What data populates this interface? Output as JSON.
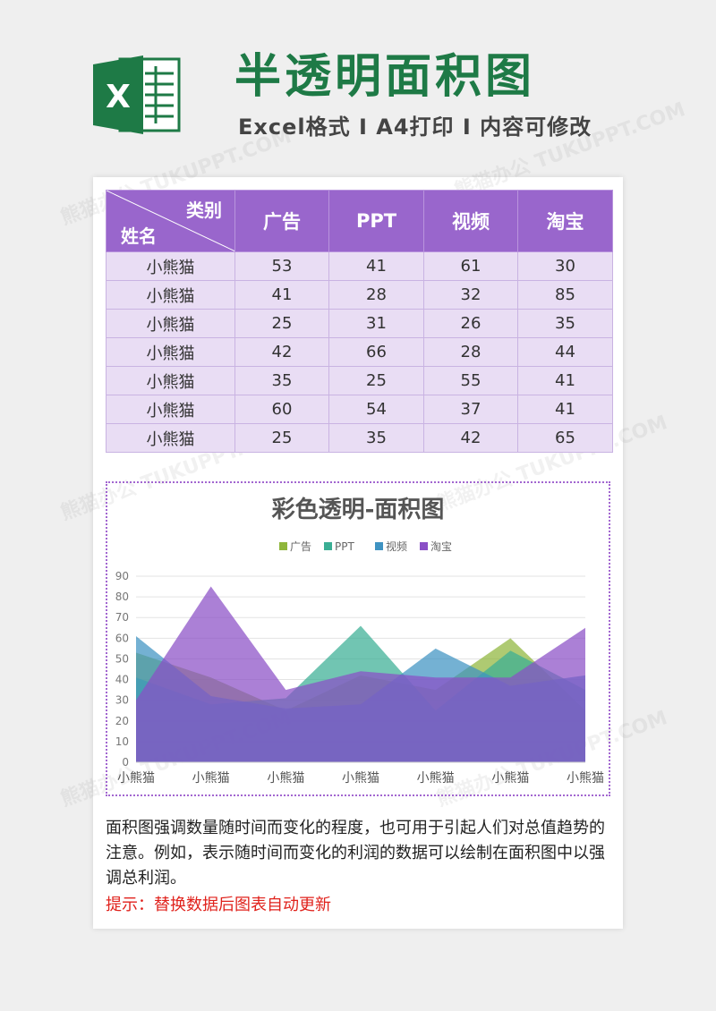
{
  "header": {
    "title": "半透明面积图",
    "subtitle": "Excel格式 Ⅰ A4打印 Ⅰ 内容可修改",
    "logo_letter": "X"
  },
  "watermark": "熊猫办公 TUKUPPT.COM",
  "table": {
    "corner_top": "类别",
    "corner_bottom": "姓名",
    "columns": [
      "广告",
      "PPT",
      "视频",
      "淘宝"
    ],
    "rows": [
      {
        "name": "小熊猫",
        "values": [
          "53",
          "41",
          "61",
          "30"
        ]
      },
      {
        "name": "小熊猫",
        "values": [
          "41",
          "28",
          "32",
          "85"
        ]
      },
      {
        "name": "小熊猫",
        "values": [
          "25",
          "31",
          "26",
          "35"
        ]
      },
      {
        "name": "小熊猫",
        "values": [
          "42",
          "66",
          "28",
          "44"
        ]
      },
      {
        "name": "小熊猫",
        "values": [
          "35",
          "25",
          "55",
          "41"
        ]
      },
      {
        "name": "小熊猫",
        "values": [
          "60",
          "54",
          "37",
          "41"
        ]
      },
      {
        "name": "小熊猫",
        "values": [
          "25",
          "35",
          "42",
          "65"
        ]
      }
    ]
  },
  "chart_data": {
    "type": "area",
    "title": "彩色透明-面积图",
    "categories": [
      "小熊猫",
      "小熊猫",
      "小熊猫",
      "小熊猫",
      "小熊猫",
      "小熊猫",
      "小熊猫"
    ],
    "series": [
      {
        "name": "广告",
        "color": "#8fb63b",
        "values": [
          53,
          41,
          25,
          42,
          35,
          60,
          25
        ]
      },
      {
        "name": "PPT",
        "color": "#3aae94",
        "values": [
          41,
          28,
          31,
          66,
          25,
          54,
          35
        ]
      },
      {
        "name": "视频",
        "color": "#3f93c2",
        "values": [
          61,
          32,
          26,
          28,
          55,
          37,
          42
        ]
      },
      {
        "name": "淘宝",
        "color": "#8a4fc6",
        "values": [
          30,
          85,
          35,
          44,
          41,
          41,
          65
        ]
      }
    ],
    "ylim": [
      0,
      90
    ],
    "yticks": [
      0,
      10,
      20,
      30,
      40,
      50,
      60,
      70,
      80,
      90
    ],
    "grid": true,
    "legend": "top"
  },
  "description": "面积图强调数量随时间而变化的程度，也可用于引起人们对总值趋势的注意。例如，表示随时间而变化的利润的数据可以绘制在面积图中以强调总利润。",
  "hint": "提示：替换数据后图表自动更新"
}
